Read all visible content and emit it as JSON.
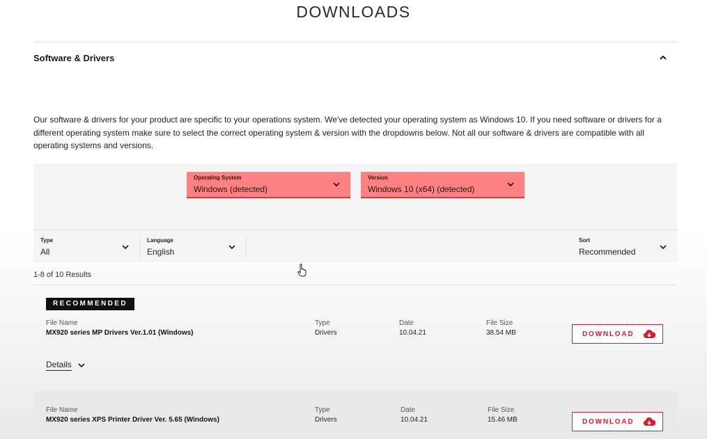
{
  "page": {
    "title": "DOWNLOADS"
  },
  "section": {
    "title": "Software & Drivers"
  },
  "intro_text": "Our software & drivers for your product are specific to your operations system. We've detected your operating system as Windows 10. If you need software or drivers for a different operating system make sure to select the correct operating system & version with the dropdowns below. Not all our software & drivers are compatible with all operating systems and versions.",
  "os_selector": {
    "operating_system": {
      "label": "Operating System",
      "value": "Windows (detected)"
    },
    "version": {
      "label": "Version",
      "value": "Windows 10 (x64) (detected)"
    },
    "highlight_color": "#ff8282"
  },
  "filters": {
    "type": {
      "label": "Type",
      "value": "All"
    },
    "language": {
      "label": "Language",
      "value": "English"
    },
    "sort": {
      "label": "Sort",
      "value": "Recommended"
    }
  },
  "results_count": "1-8 of 10 Results",
  "recommended_badge": "RECOMMENDED",
  "columns": {
    "file_name": "File Name",
    "type": "Type",
    "date": "Date",
    "file_size": "File Size"
  },
  "files": [
    {
      "name": "MX920 series MP Drivers Ver.1.01 (Windows)",
      "type": "Drivers",
      "date": "10.04.21",
      "size": "38.54 MB",
      "button": "DOWNLOAD"
    },
    {
      "name": "MX920 series XPS Printer Driver Ver. 5.65 (Windows)",
      "type": "Drivers",
      "date": "10.04.21",
      "size": "15.46 MB",
      "button": "DOWNLOAD"
    }
  ],
  "details_label": "Details",
  "icons": {
    "collapse": "chevron-up-icon",
    "expand": "chevron-down-icon",
    "download": "cloud-download-icon",
    "cursor": "hand-pointer-icon"
  },
  "accent_color": "#cc2233"
}
